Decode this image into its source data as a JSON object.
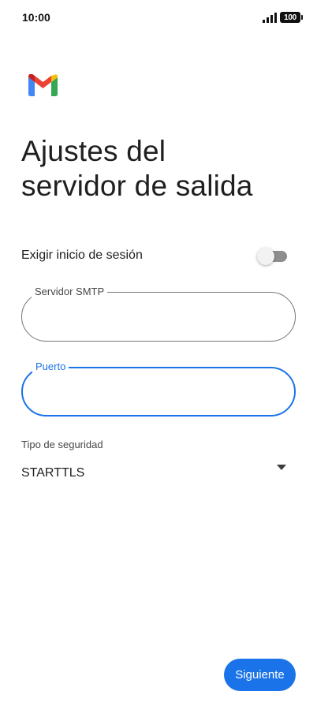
{
  "status_bar": {
    "time": "10:00",
    "battery": "100",
    "signal_icon": "signal-bars-icon",
    "battery_icon": "battery-icon"
  },
  "app": {
    "logo_icon": "gmail-logo-icon",
    "logo_colors": {
      "blue": "#4285f4",
      "green": "#34a853",
      "red": "#ea4335",
      "yellow": "#fbbc04",
      "dark_red": "#c5221f"
    }
  },
  "page": {
    "title_line1": "Ajustes del",
    "title_line2": "servidor de salida"
  },
  "require_signin": {
    "label": "Exigir inicio de sesión",
    "enabled": false
  },
  "smtp_server": {
    "label": "Servidor SMTP",
    "value": ""
  },
  "port": {
    "label": "Puerto",
    "value": "",
    "focused": true
  },
  "security": {
    "label": "Tipo de seguridad",
    "selected": "STARTTLS",
    "dropdown_icon": "dropdown-arrow-icon"
  },
  "actions": {
    "next_label": "Siguiente"
  },
  "colors": {
    "accent": "#1a73e8",
    "text_primary": "#1f1f1f",
    "text_secondary": "#444746",
    "outline": "#747775"
  }
}
